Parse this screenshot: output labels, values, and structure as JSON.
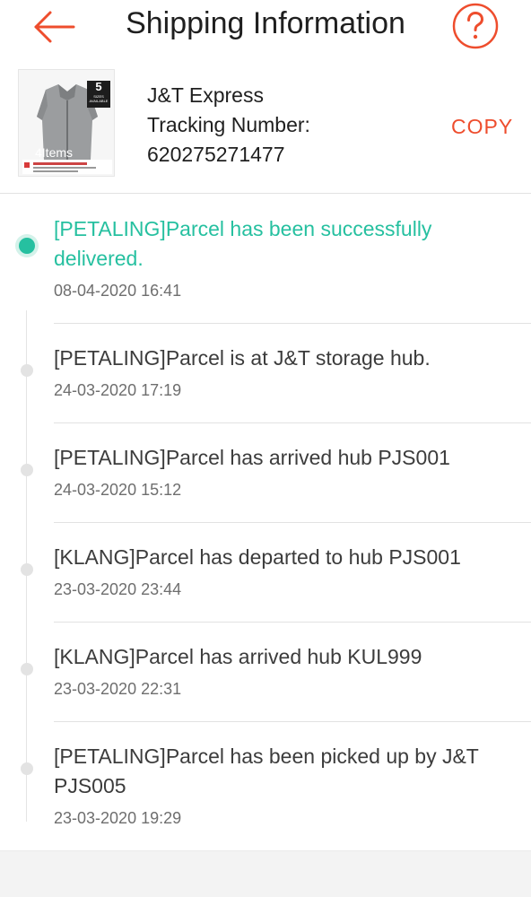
{
  "header": {
    "title": "Shipping Information",
    "back_icon": "arrow-left-icon",
    "help_icon": "question-circle-icon",
    "accent_color": "#ee4d2d"
  },
  "shipment": {
    "carrier": "J&T Express",
    "tracking_label": "Tracking Number:",
    "tracking_number": "620275271477",
    "copy_label": "COPY",
    "thumbnail": {
      "badge_number": "5",
      "badge_text": "SIZES AVAILABLE",
      "overlay_text": "4Items"
    }
  },
  "events": [
    {
      "text": "[PETALING]Parcel has been successfully delivered.",
      "time": "08-04-2020 16:41",
      "active": true
    },
    {
      "text": "[PETALING]Parcel is at J&T storage hub.",
      "time": "24-03-2020 17:19",
      "active": false
    },
    {
      "text": "[PETALING]Parcel has arrived hub PJS001",
      "time": "24-03-2020 15:12",
      "active": false
    },
    {
      "text": "[KLANG]Parcel has departed to hub PJS001",
      "time": "23-03-2020 23:44",
      "active": false
    },
    {
      "text": "[KLANG]Parcel has arrived hub KUL999",
      "time": "23-03-2020 22:31",
      "active": false
    },
    {
      "text": "[PETALING]Parcel has been picked up by J&T PJS005",
      "time": "23-03-2020 19:29",
      "active": false
    }
  ],
  "colors": {
    "delivered": "#26c0a0",
    "inactive_dot": "#e3e3e3",
    "text": "#3c3c3c",
    "timestamp": "#6e6e6e"
  }
}
